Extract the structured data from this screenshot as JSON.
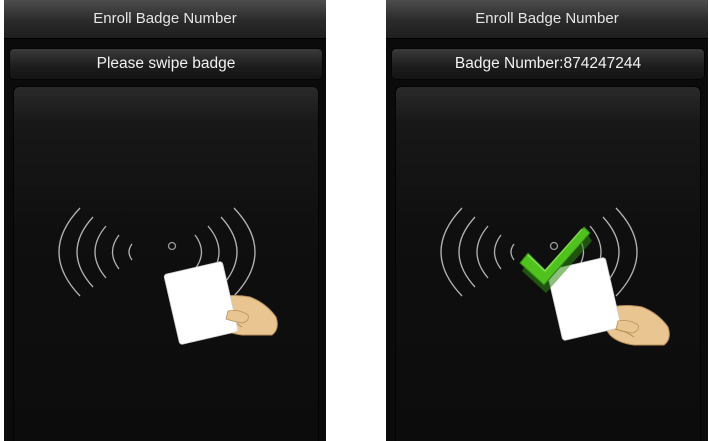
{
  "screens": [
    {
      "title": "Enroll Badge Number",
      "status": "Please swipe badge",
      "state": "waiting"
    },
    {
      "title": "Enroll Badge Number",
      "status": "Badge Number:874247244",
      "state": "success"
    }
  ],
  "colors": {
    "check_mark": "#4fc21e",
    "waves": "#cfcfcf",
    "card": "#ffffff",
    "hand": "#e9c691"
  },
  "icons": [
    "wave-icon",
    "sensor-dot-icon",
    "badge-card-icon",
    "hand-icon",
    "check-icon"
  ]
}
